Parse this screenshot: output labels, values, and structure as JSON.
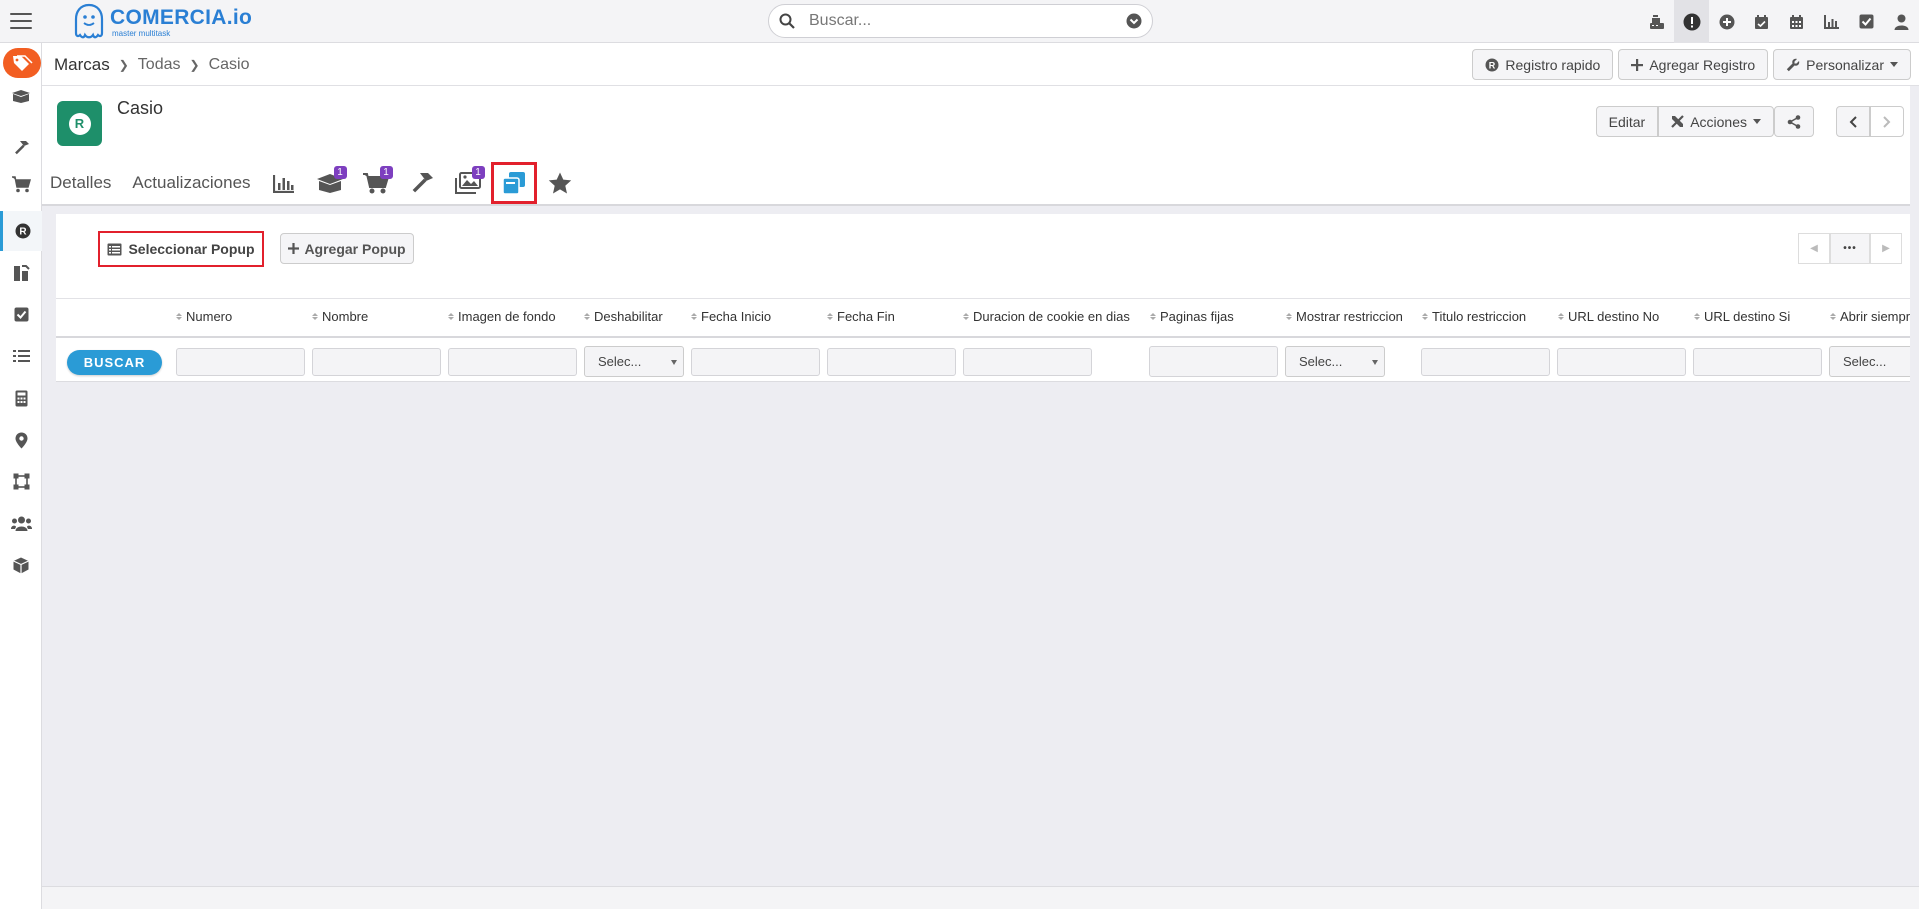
{
  "app": {
    "brand_name": "COMERCIA.io",
    "brand_tagline": "master multitask"
  },
  "search": {
    "placeholder": "Buscar..."
  },
  "breadcrumb": {
    "root": "Marcas",
    "level1": "Todas",
    "level2": "Casio"
  },
  "crumb_actions": {
    "quick_label": "Registro rapido",
    "add_label": "Agregar Registro",
    "customize_label": "Personalizar"
  },
  "record": {
    "avatar_letter": "R",
    "title": "Casio",
    "edit_label": "Editar",
    "actions_label": "Acciones"
  },
  "tabs": {
    "details": "Detalles",
    "updates": "Actualizaciones",
    "badge_products": "1",
    "badge_sales": "1",
    "badge_images": "1"
  },
  "panel": {
    "select_label": "Seleccionar Popup",
    "add_label": "Agregar Popup",
    "more_label": "•••",
    "search_button": "BUSCAR",
    "select_placeholder": "Selec..."
  },
  "columns": [
    "Numero",
    "Nombre",
    "Imagen de fondo",
    "Deshabilitar",
    "Fecha Inicio",
    "Fecha Fin",
    "Duracion de cookie en dias",
    "Paginas fijas",
    "Mostrar restriccion",
    "Titulo restriccion",
    "URL destino No",
    "URL destino Si",
    "Abrir siempre"
  ],
  "colors": {
    "accent": "#2a9bd6",
    "brand": "#2a7fd4",
    "sidebar_brand": "#f25e22",
    "avatar": "#1e8f6a",
    "badge": "#7d3fbf",
    "highlight": "#e2202c"
  }
}
